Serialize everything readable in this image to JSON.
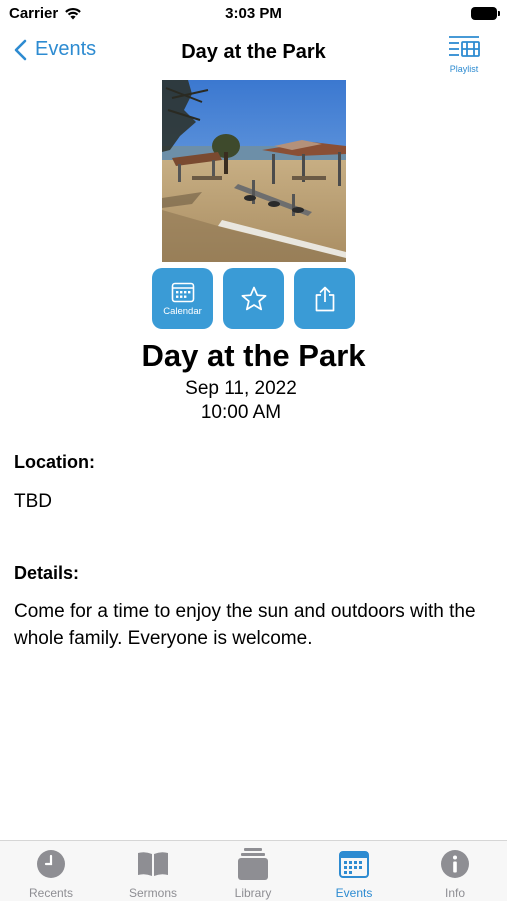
{
  "status_bar": {
    "carrier": "Carrier",
    "time": "3:03 PM"
  },
  "nav": {
    "back_label": "Events",
    "title": "Day at the Park",
    "playlist_label": "Playlist"
  },
  "actions": {
    "calendar_label": "Calendar"
  },
  "event": {
    "title": "Day at the Park",
    "date": "Sep 11, 2022",
    "time": "10:00 AM",
    "location_heading": "Location:",
    "location": "TBD",
    "details_heading": "Details:",
    "details": "Come for a time to enjoy the sun and outdoors with the whole family. Everyone is welcome."
  },
  "tabs": [
    {
      "label": "Recents",
      "icon": "clock-icon"
    },
    {
      "label": "Sermons",
      "icon": "book-icon"
    },
    {
      "label": "Library",
      "icon": "library-icon"
    },
    {
      "label": "Events",
      "icon": "calendar-icon",
      "active": true
    },
    {
      "label": "Info",
      "icon": "info-icon"
    }
  ],
  "colors": {
    "accent": "#2d8bd1",
    "button": "#3a9bd6",
    "tab_inactive": "#8e8e93"
  }
}
